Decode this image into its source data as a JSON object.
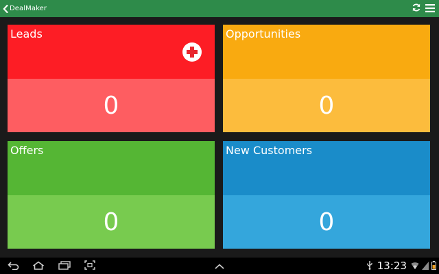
{
  "app": {
    "title": "DealMaker"
  },
  "toolbar": {
    "back_icon": "chevron-left-icon",
    "refresh_icon": "refresh-icon",
    "menu_icon": "menu-icon"
  },
  "tiles": [
    {
      "id": "leads",
      "title": "Leads",
      "count": "0",
      "has_add_button": true,
      "top_color": "#fd1d25",
      "bottom_color": "#fe5d61"
    },
    {
      "id": "opportunities",
      "title": "Opportunities",
      "count": "0",
      "top_color": "#f9aa10",
      "bottom_color": "#fcbc3d"
    },
    {
      "id": "offers",
      "title": "Offers",
      "count": "0",
      "top_color": "#55b634",
      "bottom_color": "#78cb4f"
    },
    {
      "id": "new-customers",
      "title": "New Customers",
      "count": "0",
      "top_color": "#1a8cc9",
      "bottom_color": "#34a6dc"
    }
  ],
  "system_bar": {
    "time": "13:23",
    "icons": [
      "back-icon",
      "home-icon",
      "recent-apps-icon",
      "screenshot-icon",
      "up-chevron-icon",
      "usb-icon",
      "wifi-icon",
      "battery-icon"
    ]
  },
  "colors": {
    "actionbar": "#2e8b4a",
    "background": "#1a1a1a"
  }
}
